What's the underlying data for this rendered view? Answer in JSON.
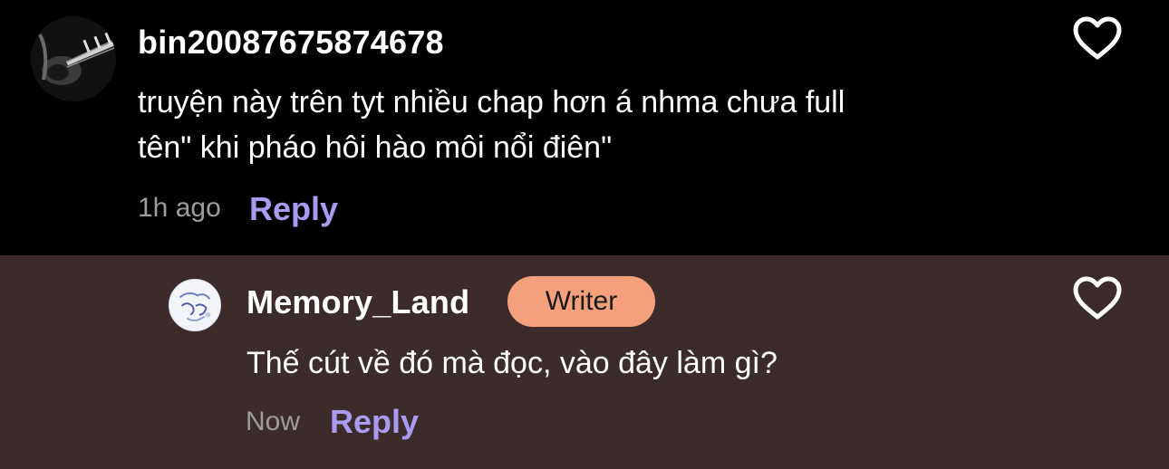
{
  "comments": [
    {
      "username": "bin20087675874678",
      "text_line1": "truyện này  trên  tyt nhiều chap hơn á nhma chưa full",
      "text_line2": "tên\" khi pháo hôi hào môi nổi điên\"",
      "timestamp": "1h ago",
      "reply_label": "Reply",
      "avatar_icon": "guitar-avatar-icon",
      "like_icon": "heart-outline-icon"
    }
  ],
  "reply": {
    "username": "Memory_Land",
    "badge": "Writer",
    "text": "Thế cút về đó mà đọc, vào đây làm gì?",
    "timestamp": "Now",
    "reply_label": "Reply",
    "avatar_icon": "anime-avatar-icon",
    "like_icon": "heart-outline-icon"
  },
  "colors": {
    "background_top": "#000000",
    "background_reply": "#3b2c2b",
    "reply_link": "#a99cf0",
    "badge_bg": "#f4a07c",
    "timestamp": "#9c9c9c"
  }
}
